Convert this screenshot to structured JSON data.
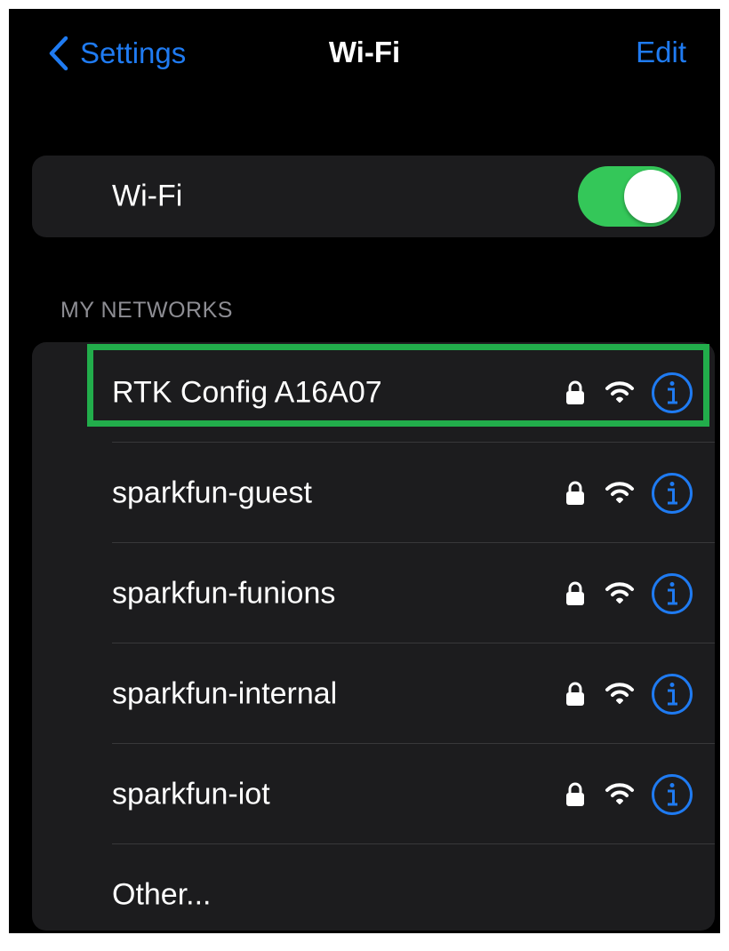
{
  "nav": {
    "back_label": "Settings",
    "title": "Wi-Fi",
    "edit_label": "Edit"
  },
  "wifi_toggle": {
    "label": "Wi-Fi",
    "state": "on"
  },
  "my_networks": {
    "header": "MY NETWORKS",
    "networks": [
      {
        "name": "RTK Config A16A07",
        "secured": true,
        "highlighted": true
      },
      {
        "name": "sparkfun-guest",
        "secured": true
      },
      {
        "name": "sparkfun-funions",
        "secured": true
      },
      {
        "name": "sparkfun-internal",
        "secured": true
      },
      {
        "name": "sparkfun-iot",
        "secured": true
      }
    ],
    "other_label": "Other..."
  },
  "icons": {
    "back": "chevron-left-icon",
    "lock": "lock-icon",
    "signal": "wifi-signal-icon",
    "info": "info-icon"
  },
  "colors": {
    "accent": "#1f7bf2",
    "toggle_on": "#34c759",
    "highlight": "#22ad4b",
    "background": "#000000",
    "group_background": "#1c1c1e"
  }
}
